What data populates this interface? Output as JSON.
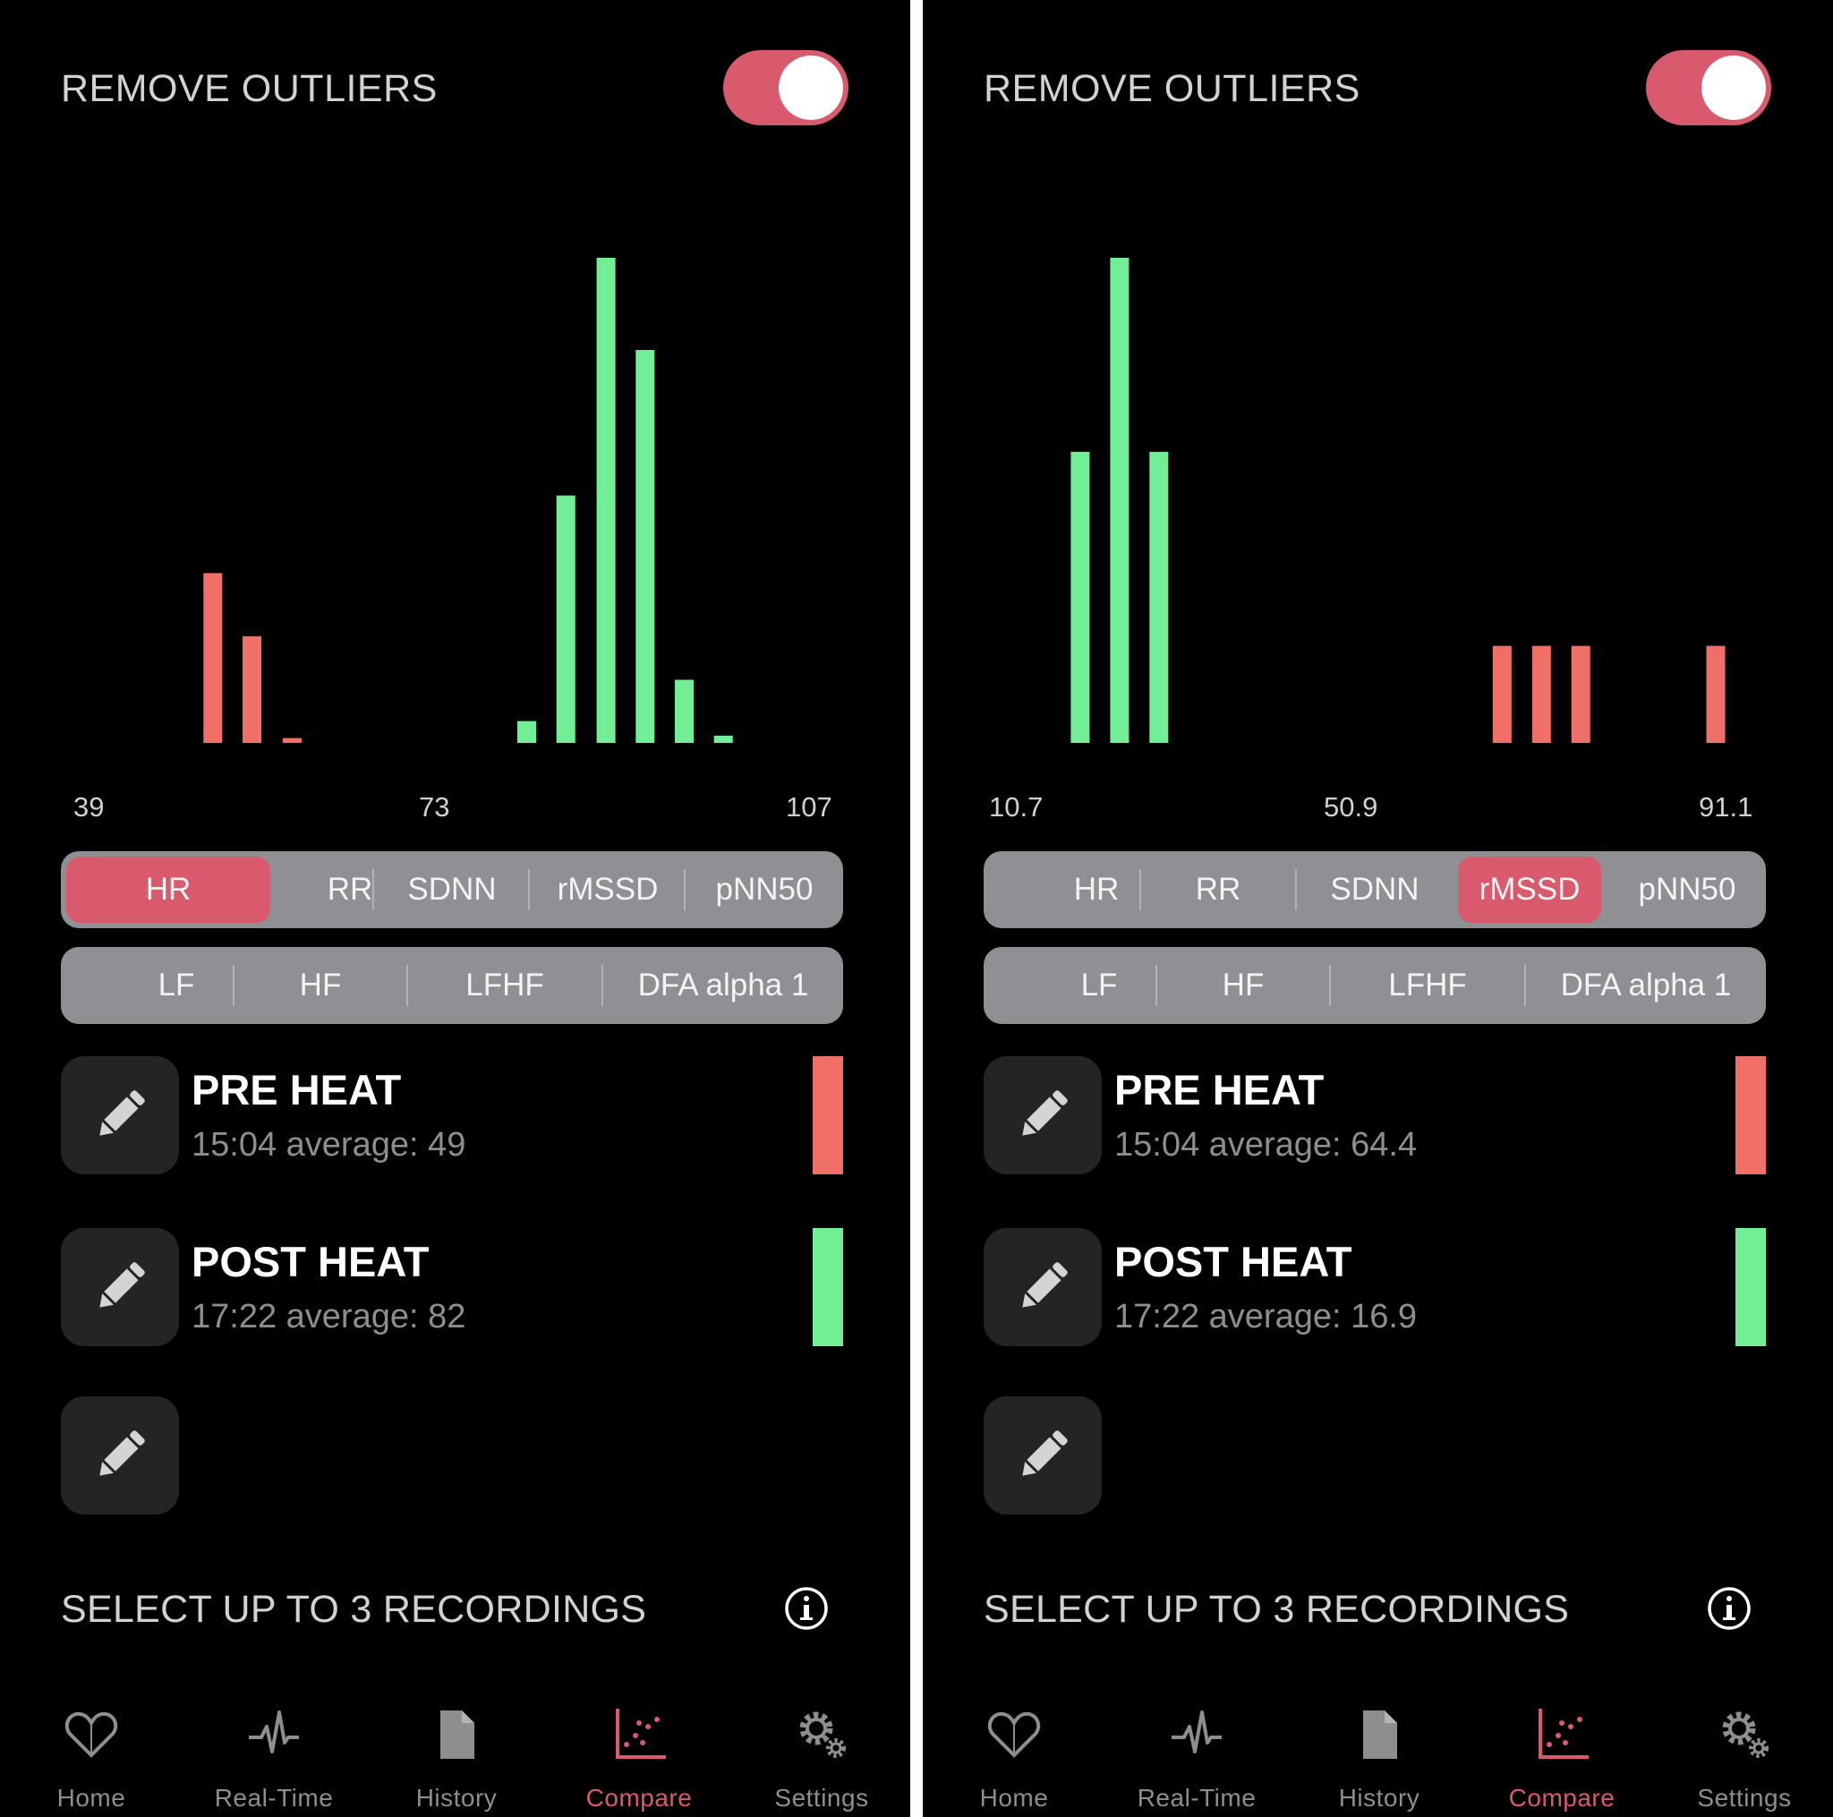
{
  "colors": {
    "accent": "#d95a6c",
    "recording1": "#f07067",
    "recording2": "#72ee96",
    "segment_bg": "#8f8f94",
    "button_bg": "#242424"
  },
  "panels": [
    {
      "remove_outliers_label": "REMOVE OUTLIERS",
      "remove_outliers_on": true,
      "metric_row1": [
        {
          "label": "HR",
          "selected": true
        },
        {
          "label": "RR",
          "selected": false
        },
        {
          "label": "SDNN",
          "selected": false
        },
        {
          "label": "rMSSD",
          "selected": false
        },
        {
          "label": "pNN50",
          "selected": false
        }
      ],
      "metric_row2": [
        {
          "label": "LF",
          "selected": false
        },
        {
          "label": "HF",
          "selected": false
        },
        {
          "label": "LFHF",
          "selected": false
        },
        {
          "label": "DFA alpha 1",
          "selected": false
        }
      ],
      "chart_data": {
        "type": "bar",
        "x_ticks": [
          "39",
          "73",
          "107"
        ],
        "xlim": [
          39,
          107
        ],
        "series": [
          {
            "color": "#f07067",
            "x": [
              50.5,
              54.2,
              58.0
            ],
            "values": [
              0.35,
              0.22,
              0.01
            ]
          },
          {
            "color": "#72ee96",
            "x": [
              80.2,
              83.9,
              87.7,
              91.4,
              95.1,
              98.8
            ],
            "values": [
              0.045,
              0.51,
              1.0,
              0.81,
              0.13,
              0.015
            ]
          }
        ]
      },
      "recordings": [
        {
          "name": "PRE HEAT",
          "meta": "15:04 average: 49",
          "color": "#f07067"
        },
        {
          "name": "POST HEAT",
          "meta": "17:22 average: 82",
          "color": "#72ee96"
        },
        {
          "name": "",
          "meta": "",
          "color": ""
        }
      ],
      "select_label": "SELECT UP TO 3 RECORDINGS"
    },
    {
      "remove_outliers_label": "REMOVE OUTLIERS",
      "remove_outliers_on": true,
      "metric_row1": [
        {
          "label": "HR",
          "selected": false
        },
        {
          "label": "RR",
          "selected": false
        },
        {
          "label": "SDNN",
          "selected": false
        },
        {
          "label": "rMSSD",
          "selected": true
        },
        {
          "label": "pNN50",
          "selected": false
        }
      ],
      "metric_row2": [
        {
          "label": "LF",
          "selected": false
        },
        {
          "label": "HF",
          "selected": false
        },
        {
          "label": "LFHF",
          "selected": false
        },
        {
          "label": "DFA alpha 1",
          "selected": false
        }
      ],
      "chart_data": {
        "type": "bar",
        "x_ticks": [
          "10.7",
          "50.9",
          "91.1"
        ],
        "xlim": [
          10.7,
          91.1
        ],
        "series": [
          {
            "color": "#72ee96",
            "x": [
              18.1,
              22.5,
              26.9
            ],
            "values": [
              0.6,
              1.0,
              0.6
            ]
          },
          {
            "color": "#f07067",
            "x": [
              65.3,
              69.7,
              74.1,
              89.2
            ],
            "values": [
              0.2,
              0.2,
              0.2,
              0.2
            ]
          }
        ]
      },
      "recordings": [
        {
          "name": "PRE HEAT",
          "meta": "15:04 average: 64.4",
          "color": "#f07067"
        },
        {
          "name": "POST HEAT",
          "meta": "17:22 average: 16.9",
          "color": "#72ee96"
        },
        {
          "name": "",
          "meta": "",
          "color": ""
        }
      ],
      "select_label": "SELECT UP TO 3 RECORDINGS"
    }
  ],
  "tabbar": [
    {
      "label": "Home",
      "icon": "home-heart-icon",
      "active": false
    },
    {
      "label": "Real-Time",
      "icon": "pulse-icon",
      "active": false
    },
    {
      "label": "History",
      "icon": "document-icon",
      "active": false
    },
    {
      "label": "Compare",
      "icon": "scatter-chart-icon",
      "active": true
    },
    {
      "label": "Settings",
      "icon": "gears-icon",
      "active": false
    }
  ]
}
